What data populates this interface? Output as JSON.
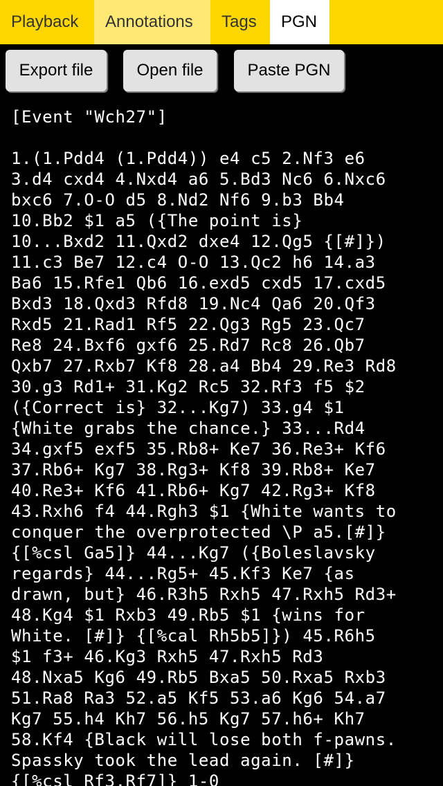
{
  "tabs": [
    {
      "label": "Playback"
    },
    {
      "label": "Annotations"
    },
    {
      "label": "Tags"
    },
    {
      "label": "PGN"
    }
  ],
  "active_tab": "PGN",
  "toolbar": {
    "export_label": "Export file",
    "open_label": "Open file",
    "paste_label": "Paste PGN"
  },
  "pgn": {
    "lines": [
      "[Event \"Wch27\"]",
      "",
      "1.(1.Pdd4 (1.Pdd4)) e4 c5 2.Nf3 e6",
      "3.d4 cxd4 4.Nxd4 a6 5.Bd3 Nc6 6.Nxc6",
      "bxc6 7.O-O d5 8.Nd2 Nf6 9.b3 Bb4",
      "10.Bb2 $1 a5 ({The point is}",
      "10...Bxd2 11.Qxd2 dxe4 12.Qg5 {[#]})",
      "11.c3 Be7 12.c4 O-O 13.Qc2 h6 14.a3",
      "Ba6 15.Rfe1 Qb6 16.exd5 cxd5 17.cxd5",
      "Bxd3 18.Qxd3 Rfd8 19.Nc4 Qa6 20.Qf3",
      "Rxd5 21.Rad1 Rf5 22.Qg3 Rg5 23.Qc7",
      "Re8 24.Bxf6 gxf6 25.Rd7 Rc8 26.Qb7",
      "Qxb7 27.Rxb7 Kf8 28.a4 Bb4 29.Re3 Rd8",
      "30.g3 Rd1+ 31.Kg2 Rc5 32.Rf3 f5 $2",
      "({Correct is} 32...Kg7) 33.g4 $1",
      "{White grabs the chance.} 33...Rd4",
      "34.gxf5 exf5 35.Rb8+ Ke7 36.Re3+ Kf6",
      "37.Rb6+ Kg7 38.Rg3+ Kf8 39.Rb8+ Ke7",
      "40.Re3+ Kf6 41.Rb6+ Kg7 42.Rg3+ Kf8",
      "43.Rxh6 f4 44.Rgh3 $1 {White wants to",
      "conquer the overprotected \\P a5.[#]}",
      "{[%csl Ga5]} 44...Kg7 ({Boleslavsky",
      "regards} 44...Rg5+ 45.Kf3 Ke7 {as",
      "drawn, but} 46.R3h5 Rxh5 47.Rxh5 Rd3+",
      "48.Kg4 $1 Rxb3 49.Rb5 $1 {wins for",
      "White. [#]} {[%cal Rh5b5]}) 45.R6h5",
      "$1 f3+ 46.Kg3 Rxh5 47.Rxh5 Rd3",
      "48.Nxa5 Kg6 49.Rb5 Bxa5 50.Rxa5 Rxb3",
      "51.Ra8 Ra3 52.a5 Kf5 53.a6 Kg6 54.a7",
      "Kg7 55.h4 Kh7 56.h5 Kg7 57.h6+ Kh7",
      "58.Kf4 {Black will lose both f-pawns.",
      "Spassky took the lead again. [#]}",
      "{[%csl Rf3,Rf7]} 1-0"
    ]
  },
  "colors": {
    "tab_bar": "#FFD700",
    "tab_inactive_light": "#FFE873",
    "tab_active": "#FFFFFF",
    "background": "#000000",
    "text": "#FFFFFF",
    "button": "#E2E2E2"
  }
}
